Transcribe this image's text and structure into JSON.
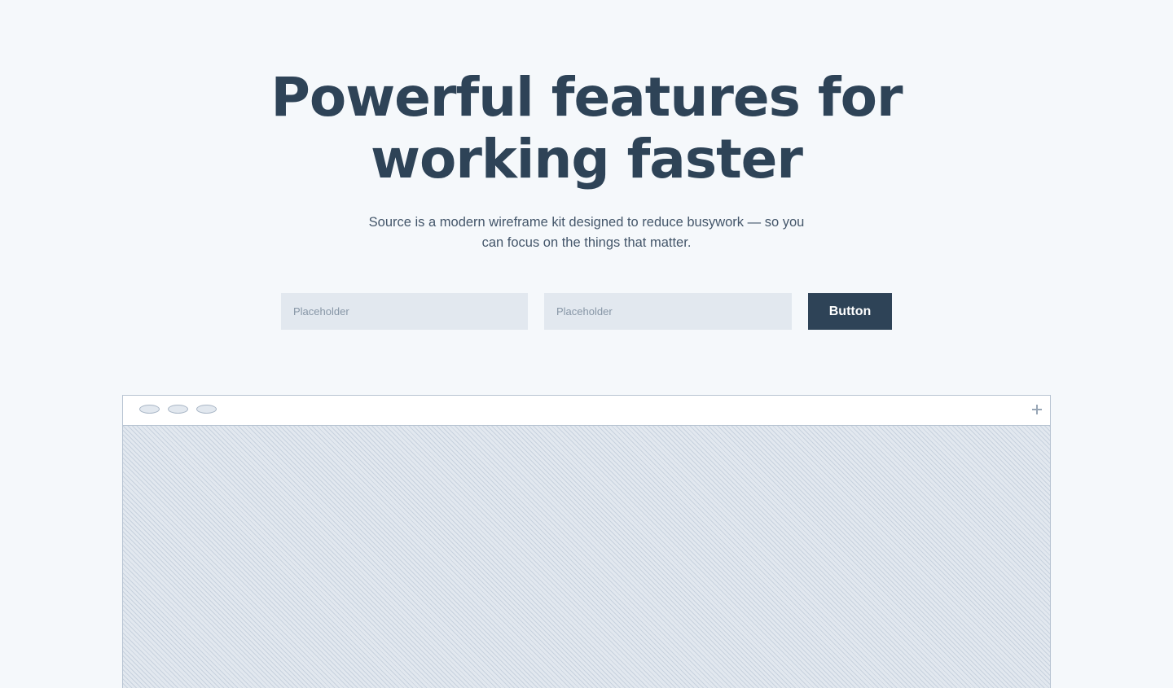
{
  "hero": {
    "title_lines": [
      "Powerful features for",
      "working faster"
    ],
    "subtitle_lines": [
      "Source is a modern wireframe kit designed to reduce busywork — so you",
      "can focus on the things that matter."
    ]
  },
  "form": {
    "input1_placeholder": "Placeholder",
    "input2_placeholder": "Placeholder",
    "button_label": "Button"
  },
  "browser_mock": {
    "window_controls": [
      "window-dot",
      "window-dot",
      "window-dot"
    ],
    "new_tab_icon": "plus-icon"
  },
  "colors": {
    "background": "#f5f8fb",
    "heading": "#2e4357",
    "input_bg": "#e2e8ef",
    "button_bg": "#2e4357",
    "button_text": "#ffffff",
    "border": "#b8c4d2"
  }
}
